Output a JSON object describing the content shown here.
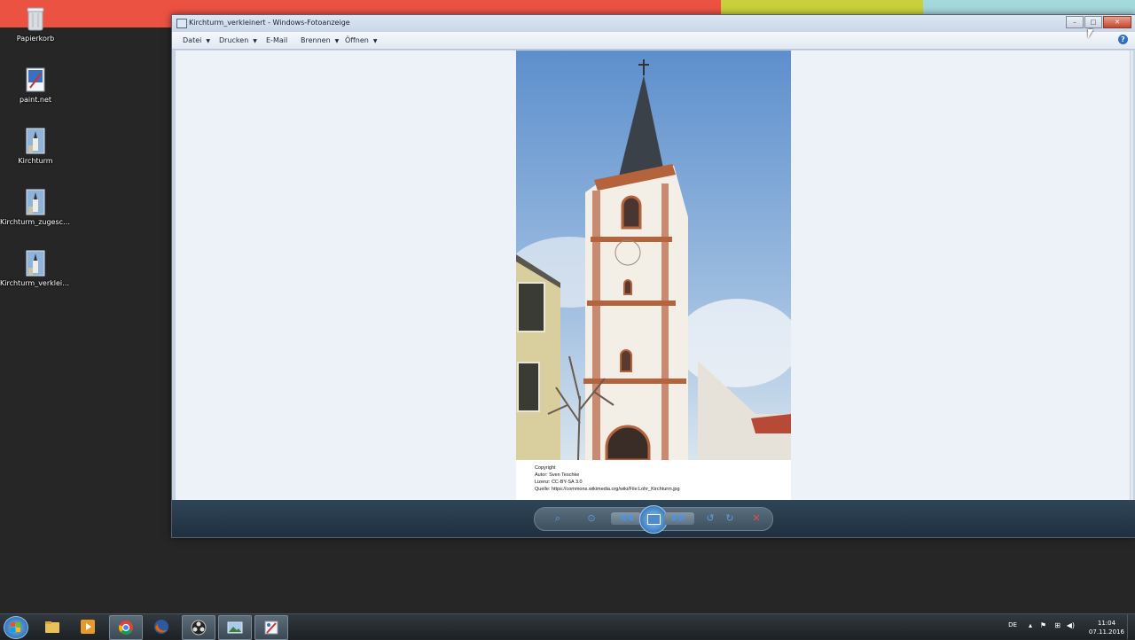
{
  "colors": {
    "strip": [
      "#ec5242",
      "#c8d13a",
      "#a4d9dc"
    ],
    "desktop_bg": "#262626",
    "viewer_bg": "#edf2f9",
    "controlbar_bg": "#263848",
    "taskbar_bg": "#24292d"
  },
  "desktop_icons": [
    {
      "label": "Papierkorb",
      "icon": "recycle-bin-icon"
    },
    {
      "label": "paint.net",
      "icon": "paintnet-icon"
    },
    {
      "label": "Kirchturm",
      "icon": "image-file-icon"
    },
    {
      "label": "Kirchturm_zugesch...",
      "icon": "image-file-icon"
    },
    {
      "label": "Kirchturm_verkleinert",
      "icon": "image-file-icon"
    }
  ],
  "window": {
    "title": "Kirchturm_verkleinert - Windows-Fotoanzeige",
    "buttons": {
      "minimize": "–",
      "maximize": "□",
      "close": "✕"
    },
    "menu": [
      {
        "label": "Datei",
        "has_dropdown": true
      },
      {
        "label": "Drucken",
        "has_dropdown": true
      },
      {
        "label": "E-Mail",
        "has_dropdown": false
      },
      {
        "label": "Brennen",
        "has_dropdown": true
      },
      {
        "label": "Öffnen",
        "has_dropdown": true
      }
    ],
    "help_label": "?"
  },
  "photo_caption": {
    "line1": "Copyright",
    "line2": "Autor: Sven Teschke",
    "line3": "Lizenz: CC-BY-SA 3.0",
    "line4": "Quelle: https://commons.wikimedia.org/wiki/File:Lohr_Kirchturm.jpg"
  },
  "controls": {
    "zoom_icon": "magnifier-icon",
    "fit_icon": "actual-size-icon",
    "prev_icon": "previous-icon",
    "slideshow_icon": "slideshow-icon",
    "next_icon": "next-icon",
    "rotate_left_icon": "rotate-counterclockwise-icon",
    "rotate_right_icon": "rotate-clockwise-icon",
    "delete_icon": "delete-icon"
  },
  "taskbar": {
    "apps": [
      {
        "name": "explorer",
        "icon": "folder-icon"
      },
      {
        "name": "media-player",
        "icon": "media-player-icon"
      },
      {
        "name": "chrome",
        "icon": "chrome-icon"
      },
      {
        "name": "firefox",
        "icon": "firefox-icon"
      },
      {
        "name": "obs",
        "icon": "obs-icon"
      },
      {
        "name": "photo-viewer",
        "icon": "photo-viewer-icon"
      },
      {
        "name": "paint.net",
        "icon": "paintnet-icon"
      }
    ],
    "language": "DE",
    "time": "11:04",
    "date": "07.11.2016"
  }
}
